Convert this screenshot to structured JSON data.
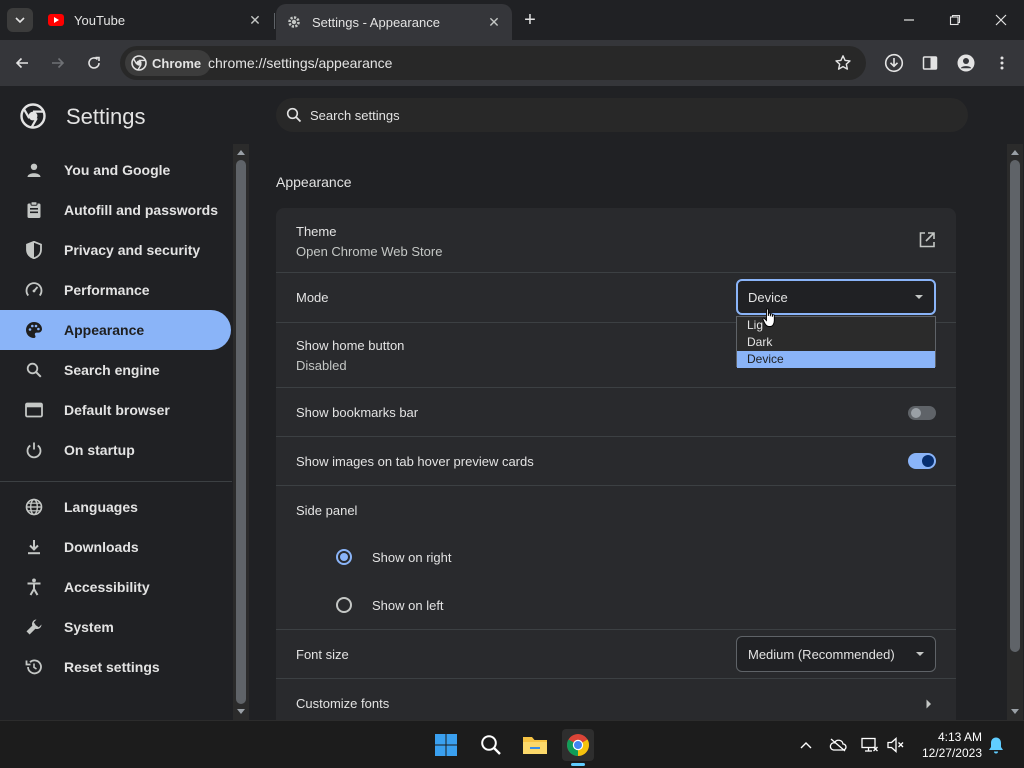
{
  "browser": {
    "tabs": [
      {
        "title": "YouTube",
        "active": false
      },
      {
        "title": "Settings - Appearance",
        "active": true
      }
    ],
    "omnibox": {
      "chip_label": "Chrome",
      "url": "chrome://settings/appearance"
    }
  },
  "settings": {
    "title": "Settings",
    "search_placeholder": "Search settings",
    "nav": {
      "items": [
        {
          "label": "You and Google",
          "icon": "person-icon"
        },
        {
          "label": "Autofill and passwords",
          "icon": "clipboard-icon"
        },
        {
          "label": "Privacy and security",
          "icon": "shield-icon"
        },
        {
          "label": "Performance",
          "icon": "speedometer-icon"
        },
        {
          "label": "Appearance",
          "icon": "palette-icon",
          "selected": true
        },
        {
          "label": "Search engine",
          "icon": "search-icon"
        },
        {
          "label": "Default browser",
          "icon": "browser-window-icon"
        },
        {
          "label": "On startup",
          "icon": "power-icon"
        },
        {
          "label": "Languages",
          "icon": "globe-icon"
        },
        {
          "label": "Downloads",
          "icon": "download-icon"
        },
        {
          "label": "Accessibility",
          "icon": "accessibility-icon"
        },
        {
          "label": "System",
          "icon": "wrench-icon"
        },
        {
          "label": "Reset settings",
          "icon": "reset-icon"
        }
      ]
    },
    "appearance": {
      "section_title": "Appearance",
      "theme": {
        "label": "Theme",
        "sub": "Open Chrome Web Store"
      },
      "mode": {
        "label": "Mode",
        "value": "Device",
        "options": [
          "Light",
          "Dark",
          "Device"
        ],
        "highlighted": "Device",
        "visible_option_text": [
          "Lig",
          "Dark",
          "Device"
        ]
      },
      "home_button": {
        "label": "Show home button",
        "sub": "Disabled"
      },
      "bookmarks_bar": {
        "label": "Show bookmarks bar",
        "enabled": false
      },
      "tab_hover": {
        "label": "Show images on tab hover preview cards",
        "enabled": true
      },
      "side_panel": {
        "label": "Side panel",
        "options": [
          "Show on right",
          "Show on left"
        ],
        "selected": "Show on right"
      },
      "font_size": {
        "label": "Font size",
        "value": "Medium (Recommended)"
      },
      "customize_fonts": {
        "label": "Customize fonts"
      }
    }
  },
  "taskbar": {
    "time": "4:13 AM",
    "date": "12/27/2023"
  },
  "colors": {
    "accent": "#8ab4f8",
    "background": "#202124",
    "card": "#292a2d"
  }
}
